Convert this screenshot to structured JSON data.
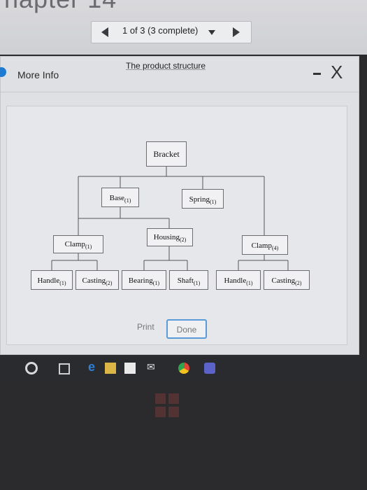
{
  "page": {
    "chapter_fragment": "hapter 14"
  },
  "pager": {
    "label": "1 of 3 (3 complete)"
  },
  "dialog": {
    "title": "More Info",
    "close_symbol": "X",
    "structure_title": "The product structure",
    "print_label": "Print",
    "done_label": "Done"
  },
  "tree": {
    "bracket": {
      "name": "Bracket",
      "qty": ""
    },
    "base": {
      "name": "Base",
      "qty": "(1)"
    },
    "spring": {
      "name": "Spring",
      "qty": "(1)"
    },
    "clamp_left": {
      "name": "Clamp",
      "qty": "(1)"
    },
    "housing": {
      "name": "Housing",
      "qty": "(2)"
    },
    "clamp_right": {
      "name": "Clamp",
      "qty": "(4)"
    },
    "handle_left": {
      "name": "Handle",
      "qty": "(1)"
    },
    "casting_left": {
      "name": "Casting",
      "qty": "(2)"
    },
    "bearing": {
      "name": "Bearing",
      "qty": "(1)"
    },
    "shaft": {
      "name": "Shaft",
      "qty": "(1)"
    },
    "handle_right": {
      "name": "Handle",
      "qty": "(1)"
    },
    "casting_right": {
      "name": "Casting",
      "qty": "(2)"
    }
  },
  "taskbar": {
    "icons": [
      "start-icon",
      "task-view-icon",
      "edge-icon",
      "file-explorer-icon",
      "store-icon",
      "mail-icon",
      "chrome-icon",
      "teams-icon"
    ]
  },
  "colors": {
    "accent": "#5a9ad6",
    "info": "#1f7bd1"
  }
}
